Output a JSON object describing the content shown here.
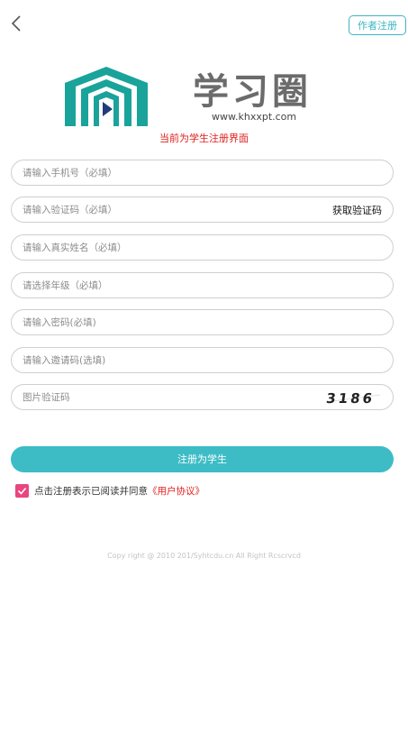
{
  "header": {
    "back_icon": "chevron-left-icon",
    "author_register_label": "作者注册"
  },
  "brand": {
    "logo_text": "学习圈",
    "url_text": "www.khxxpt.com",
    "logo_color": "#1aa39a",
    "play_color": "#1f3d7a"
  },
  "mode_notice": "当前为学生注册界面",
  "form": {
    "phone": {
      "placeholder": "请输入手机号（必填）"
    },
    "sms_code": {
      "placeholder": "请输入验证码（必填）",
      "action_label": "获取验证码"
    },
    "real_name": {
      "placeholder": "请输入真实姓名（必填）"
    },
    "grade": {
      "placeholder": "请选择年级（必填）"
    },
    "password": {
      "placeholder": "请输入密码(必填)"
    },
    "invite_code": {
      "placeholder": "请输入邀请码(选填)"
    },
    "image_captcha": {
      "placeholder": "图片验证码",
      "captcha_text": "3186"
    }
  },
  "submit_label": "注册为学生",
  "agreement": {
    "checked": true,
    "text": "点击注册表示已阅读并同意",
    "link_text": "《用户协议》"
  },
  "footer": {
    "copyright": "Copy right @ 2010 201/Syhtcdu.cn All Right Rcscrvcd"
  },
  "colors": {
    "accent": "#3dbcc6",
    "notice_red": "#e0211e",
    "checkbox_pink": "#e8467f"
  }
}
